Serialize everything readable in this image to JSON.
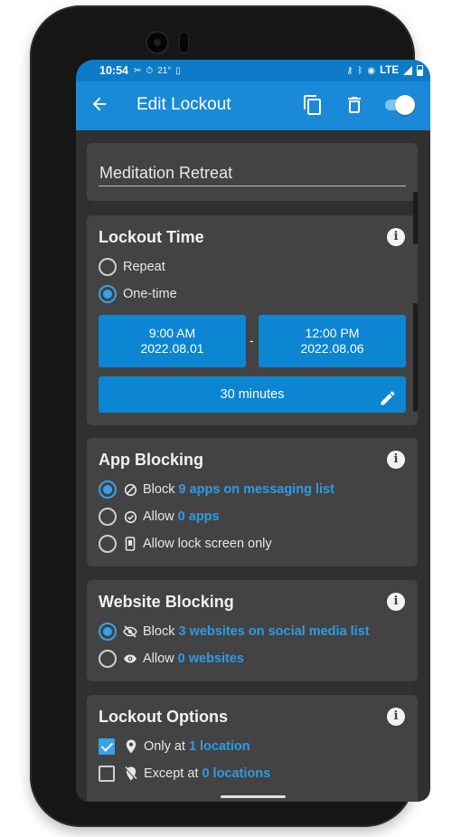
{
  "status_bar": {
    "time": "10:54",
    "temperature": "21°",
    "network": "LTE"
  },
  "app_bar": {
    "title": "Edit Lockout",
    "enabled": true
  },
  "lockout_name": {
    "value": "Meditation Retreat"
  },
  "lockout_time": {
    "title": "Lockout Time",
    "options": [
      "Repeat",
      "One-time"
    ],
    "selected": "One-time",
    "start_time": "9:00 AM",
    "start_date": "2022.08.01",
    "separator": "-",
    "end_time": "12:00 PM",
    "end_date": "2022.08.06",
    "duration": "30 minutes"
  },
  "app_blocking": {
    "title": "App Blocking",
    "block_label": "Block",
    "block_link": "9 apps on messaging list",
    "allow_label": "Allow",
    "allow_link": "0 apps",
    "lockscreen_label": "Allow lock screen only",
    "selected": "Block"
  },
  "website_blocking": {
    "title": "Website Blocking",
    "block_label": "Block",
    "block_link": "3 websites on social media list",
    "allow_label": "Allow",
    "allow_link": "0 websites",
    "selected": "Block"
  },
  "lockout_options": {
    "title": "Lockout Options",
    "only_at_label": "Only at",
    "only_at_link": "1 location",
    "only_at_checked": true,
    "except_at_label": "Except at",
    "except_at_link": "0 locations",
    "except_at_checked": false
  },
  "colors": {
    "status_bar": "#0d7bc8",
    "app_bar": "#1a8ad8",
    "background": "#303030",
    "card": "#434343",
    "accent": "#2e9be5",
    "button": "#0c86d2"
  },
  "icons": {
    "status": [
      "scissors-icon",
      "timer-icon",
      "phone-icon",
      "vpn-key-icon",
      "bluetooth-icon",
      "hotspot-icon",
      "signal-icon",
      "battery-icon"
    ],
    "app_bar": [
      "back-arrow-icon",
      "copy-icon",
      "trash-icon",
      "toggle-switch"
    ]
  }
}
